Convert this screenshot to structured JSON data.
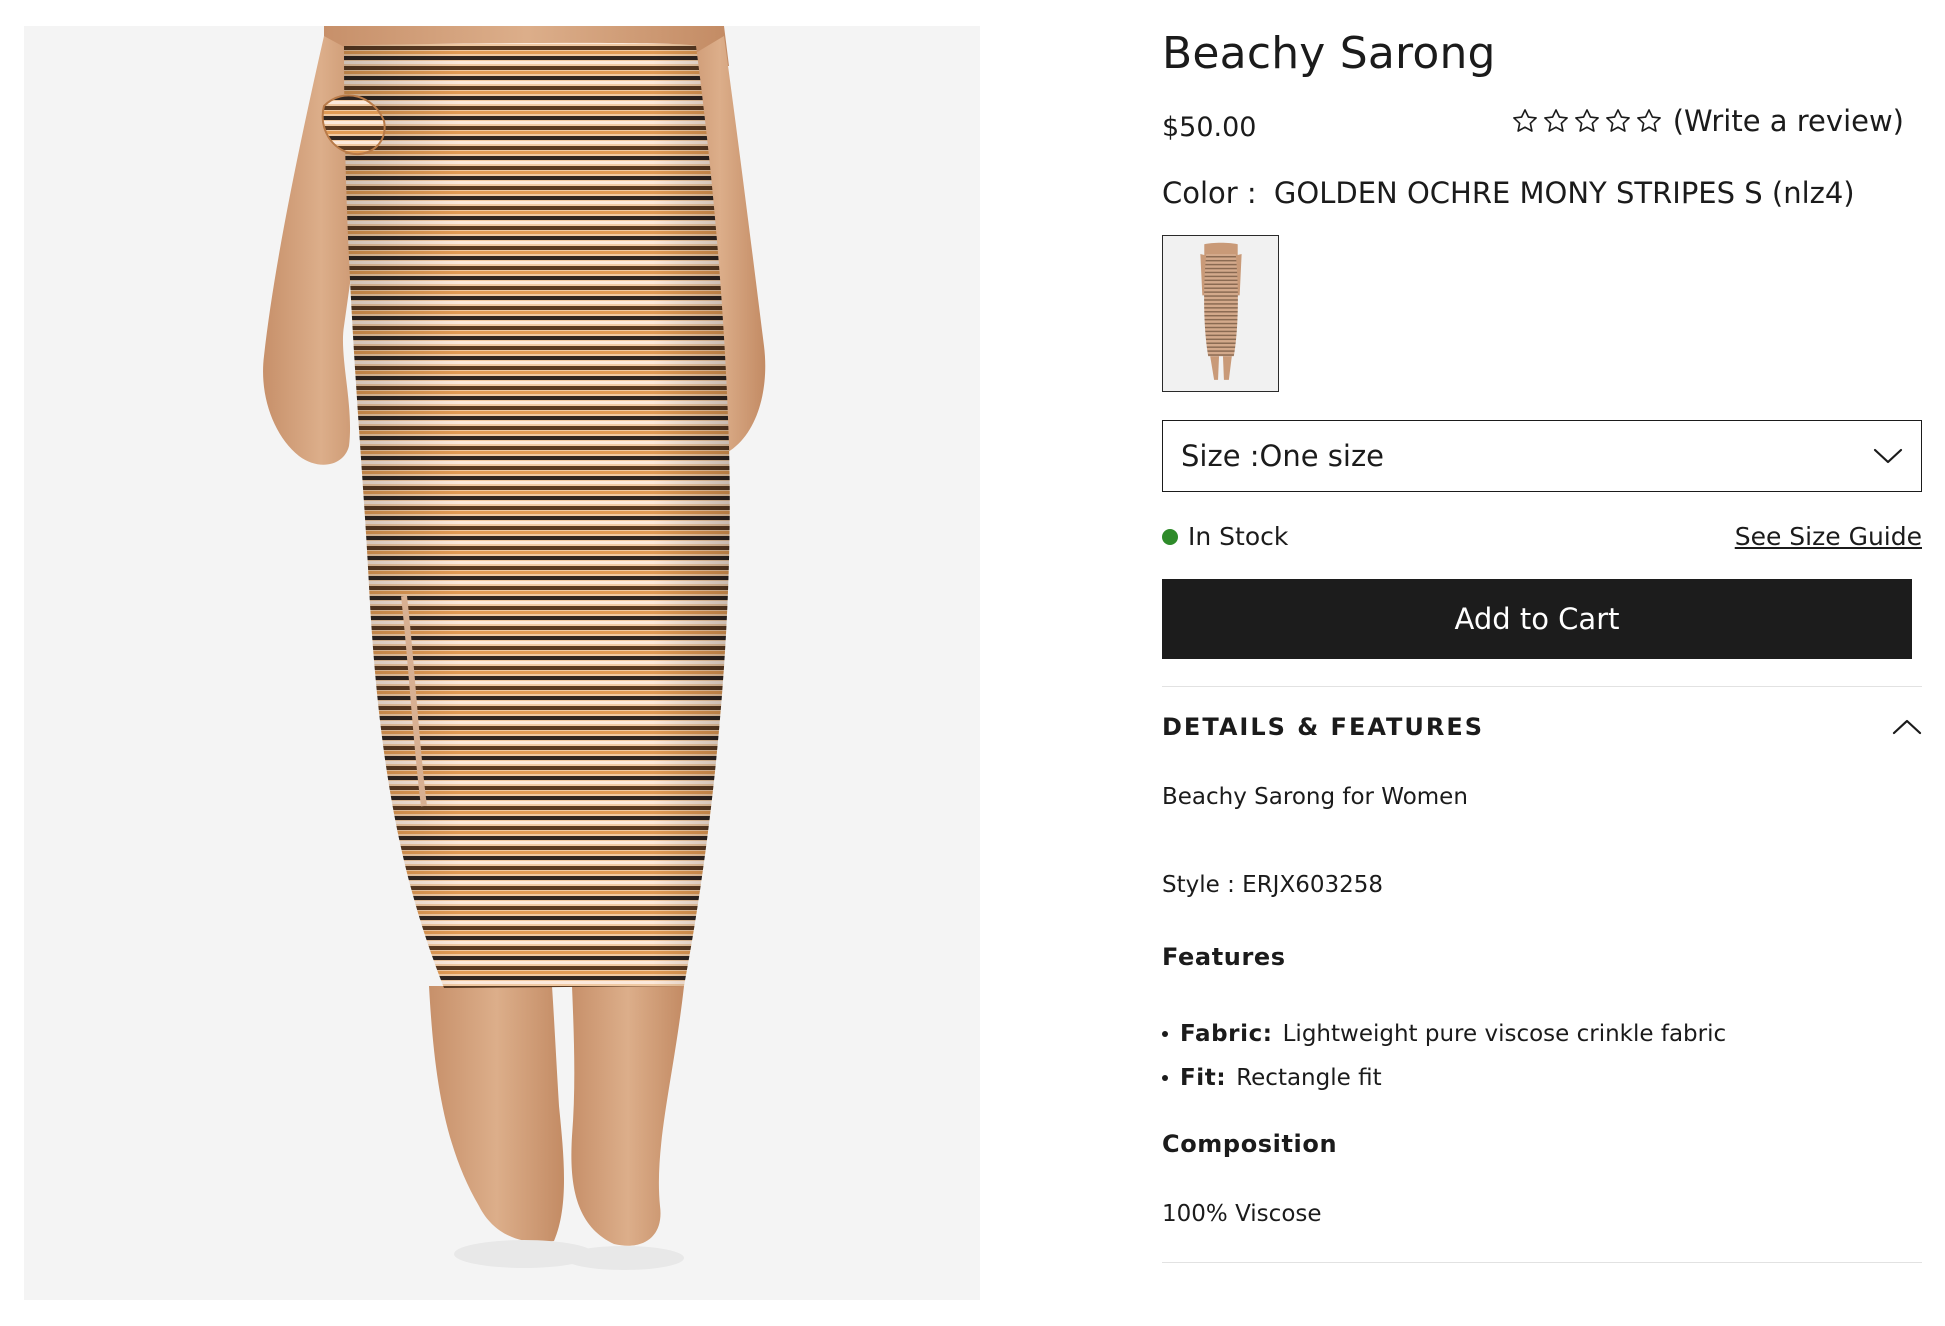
{
  "product": {
    "title": "Beachy Sarong",
    "price": "$50.00",
    "rating": {
      "value": 0,
      "max": 5,
      "review_link": "(Write a review)"
    },
    "color": {
      "label": "Color :",
      "value": "GOLDEN OCHRE MONY STRIPES S (nlz4)"
    },
    "size": {
      "label": "Size :",
      "value": "One size"
    },
    "stock": {
      "text": "In Stock",
      "color": "#2e8b2a"
    },
    "size_guide": "See Size Guide",
    "add_to_cart": "Add to Cart",
    "icons": {
      "review": "star-outline-icon",
      "dropdown": "chevron-down-icon",
      "collapse": "chevron-up-icon"
    }
  },
  "details": {
    "title": "DETAILS & FEATURES",
    "description": "Beachy Sarong for Women",
    "style_label": "Style :",
    "style_value": "ERJX603258",
    "features_title": "Features",
    "features": [
      {
        "key": "Fabric:",
        "value": "Lightweight pure viscose crinkle fabric"
      },
      {
        "key": "Fit:",
        "value": "Rectangle fit"
      }
    ],
    "composition_title": "Composition",
    "composition_value": "100% Viscose"
  },
  "colors": {
    "button_bg": "#1c1c1c",
    "stock_dot": "#2e8b2a",
    "image_bg": "#f4f4f4"
  }
}
